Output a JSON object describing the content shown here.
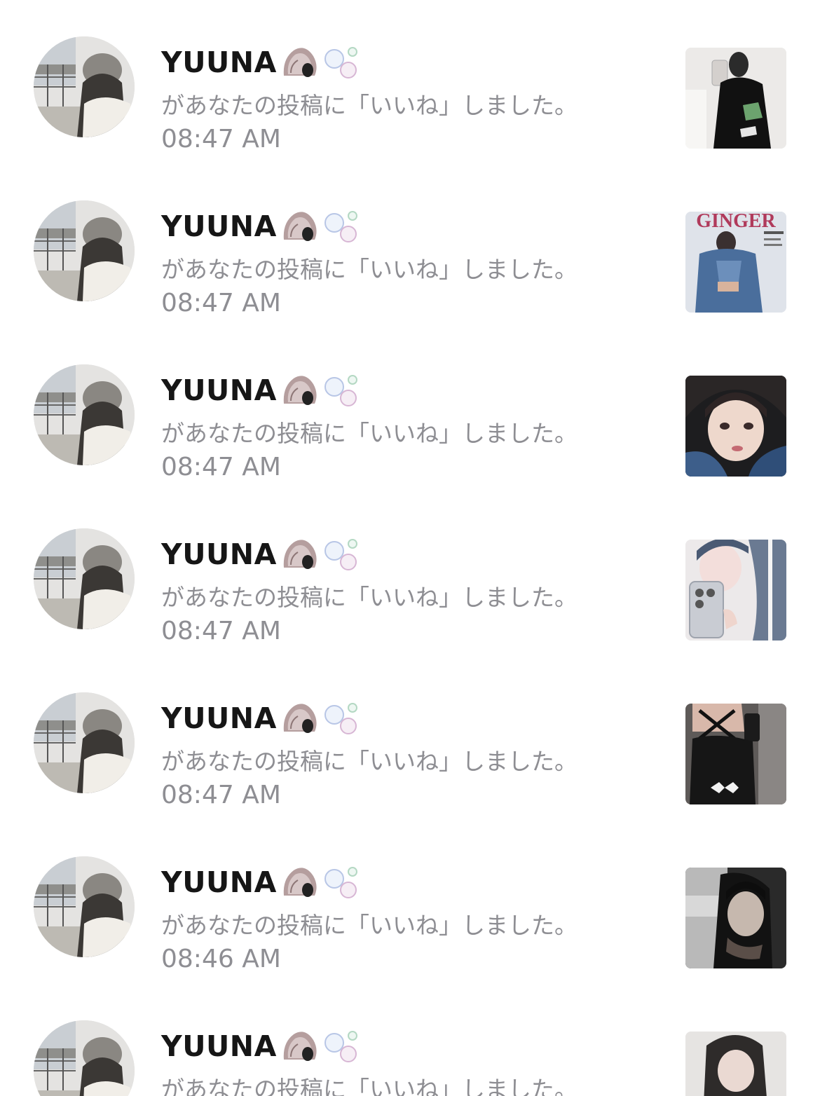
{
  "notifications": [
    {
      "username": "YUUNA",
      "emojis": [
        "spiral-shell-emoji",
        "bubbles-emoji"
      ],
      "message": "があなたの投稿に「いいね」しました。",
      "time": "08:47 AM",
      "thumbnail": "post-thumbnail-mirror-selfie"
    },
    {
      "username": "YUUNA",
      "emojis": [
        "spiral-shell-emoji",
        "bubbles-emoji"
      ],
      "message": "があなたの投稿に「いいね」しました。",
      "time": "08:47 AM",
      "thumbnail": "post-thumbnail-magazine-cover",
      "thumbnail_text": "GINGER"
    },
    {
      "username": "YUUNA",
      "emojis": [
        "spiral-shell-emoji",
        "bubbles-emoji"
      ],
      "message": "があなたの投稿に「いいね」しました。",
      "time": "08:47 AM",
      "thumbnail": "post-thumbnail-face-closeup"
    },
    {
      "username": "YUUNA",
      "emojis": [
        "spiral-shell-emoji",
        "bubbles-emoji"
      ],
      "message": "があなたの投稿に「いいね」しました。",
      "time": "08:47 AM",
      "thumbnail": "post-thumbnail-phone-selfie"
    },
    {
      "username": "YUUNA",
      "emojis": [
        "spiral-shell-emoji",
        "bubbles-emoji"
      ],
      "message": "があなたの投稿に「いいね」しました。",
      "time": "08:47 AM",
      "thumbnail": "post-thumbnail-black-outfit"
    },
    {
      "username": "YUUNA",
      "emojis": [
        "spiral-shell-emoji",
        "bubbles-emoji"
      ],
      "message": "があなたの投稿に「いいね」しました。",
      "time": "08:46 AM",
      "thumbnail": "post-thumbnail-dark-portrait"
    },
    {
      "username": "YUUNA",
      "emojis": [
        "spiral-shell-emoji",
        "bubbles-emoji"
      ],
      "message": "があなたの投稿に「いいね」しました。",
      "time": "",
      "thumbnail": "post-thumbnail-light-portrait"
    }
  ]
}
